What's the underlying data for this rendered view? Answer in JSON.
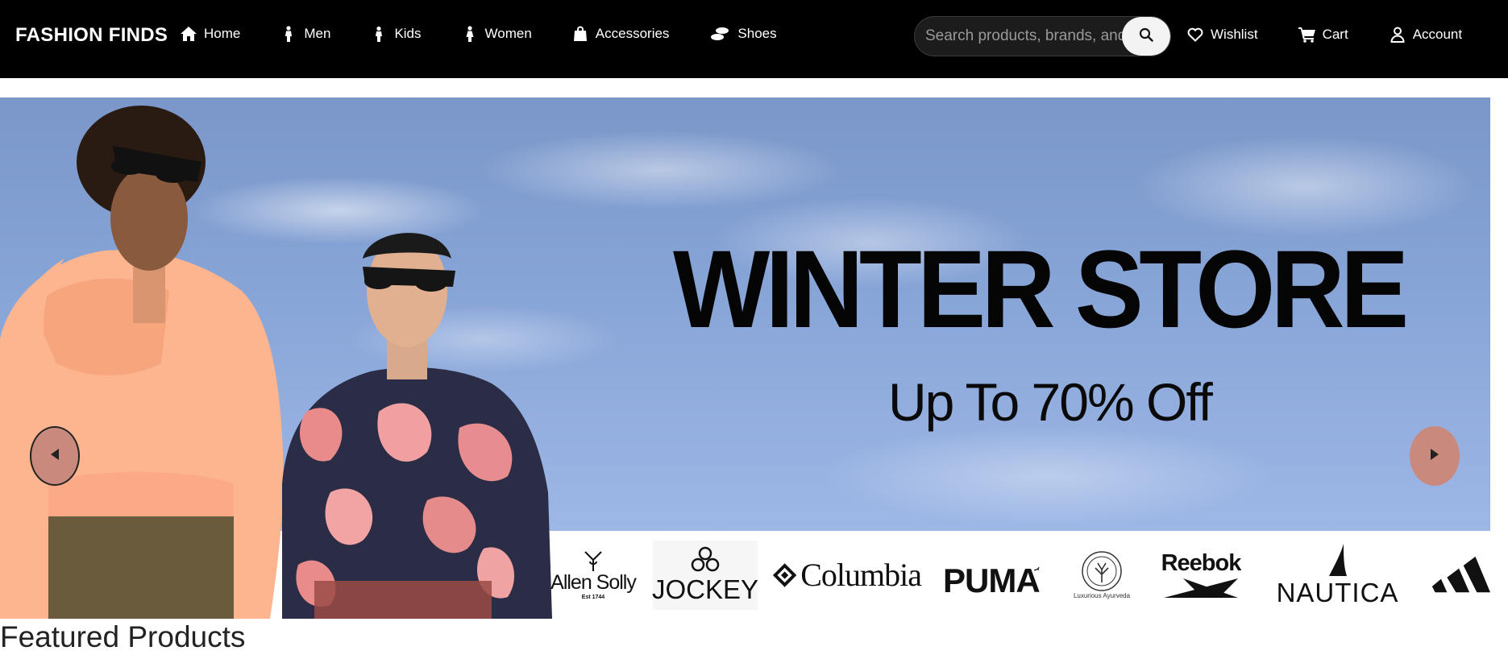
{
  "navbar": {
    "brand": "FASHION FINDS",
    "links": [
      {
        "label": "Home",
        "icon": "home-icon"
      },
      {
        "label": "Men",
        "icon": "man-icon"
      },
      {
        "label": "Kids",
        "icon": "child-icon"
      },
      {
        "label": "Women",
        "icon": "woman-icon"
      },
      {
        "label": "Accessories",
        "icon": "shopping-bag-icon"
      },
      {
        "label": "Shoes",
        "icon": "shoe-icon"
      }
    ],
    "search": {
      "placeholder": "Search products, brands, and more",
      "value": "",
      "button_icon": "search-icon"
    },
    "right_links": [
      {
        "label": "Wishlist",
        "icon": "heart-icon"
      },
      {
        "label": "Cart",
        "icon": "cart-icon"
      },
      {
        "label": "Account",
        "icon": "user-icon"
      }
    ]
  },
  "hero": {
    "title": "WINTER STORE",
    "subtitle": "Up To 70% Off",
    "prev_icon": "chevron-left-icon",
    "next_icon": "chevron-right-icon",
    "brands": [
      "Allen Solly",
      "Est 1744",
      "JOCKEY",
      "Columbia",
      "PUMA",
      "Luxurious Ayurveda",
      "Reebok",
      "NAUTICA",
      "adidas"
    ]
  },
  "featured": {
    "title": "Featured Products"
  }
}
